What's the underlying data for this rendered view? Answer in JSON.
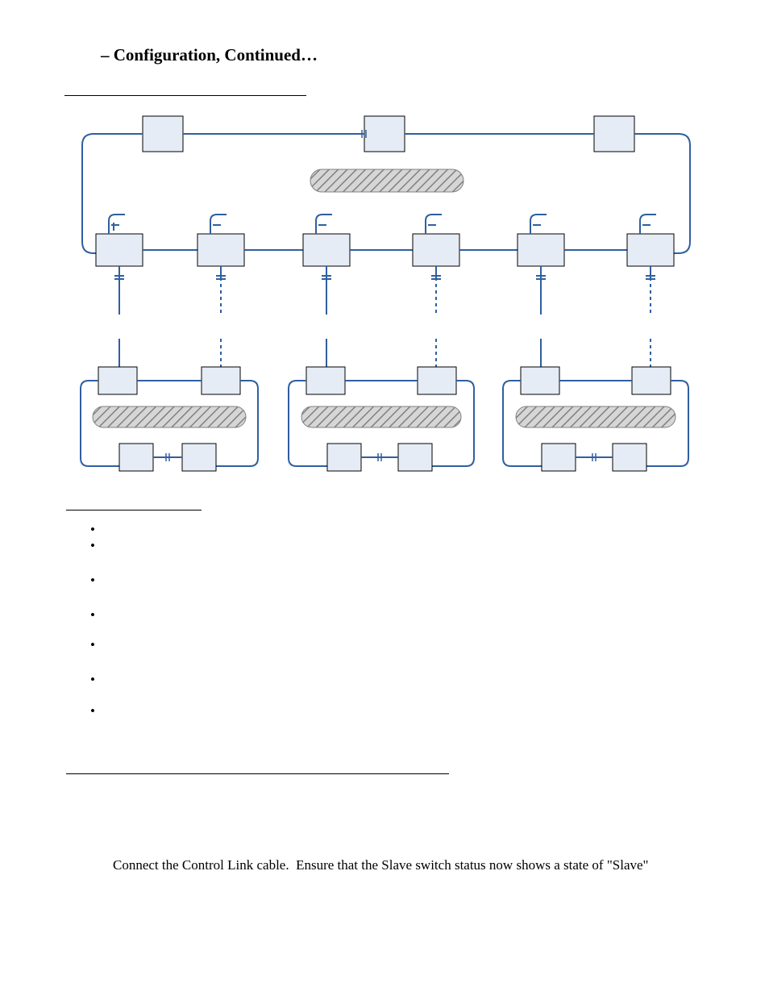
{
  "heading": "– Configuration, Continued…",
  "paragraph": "Connect the Control Link cable.  Ensure that the Slave switch status now shows a state of \"Slave\""
}
